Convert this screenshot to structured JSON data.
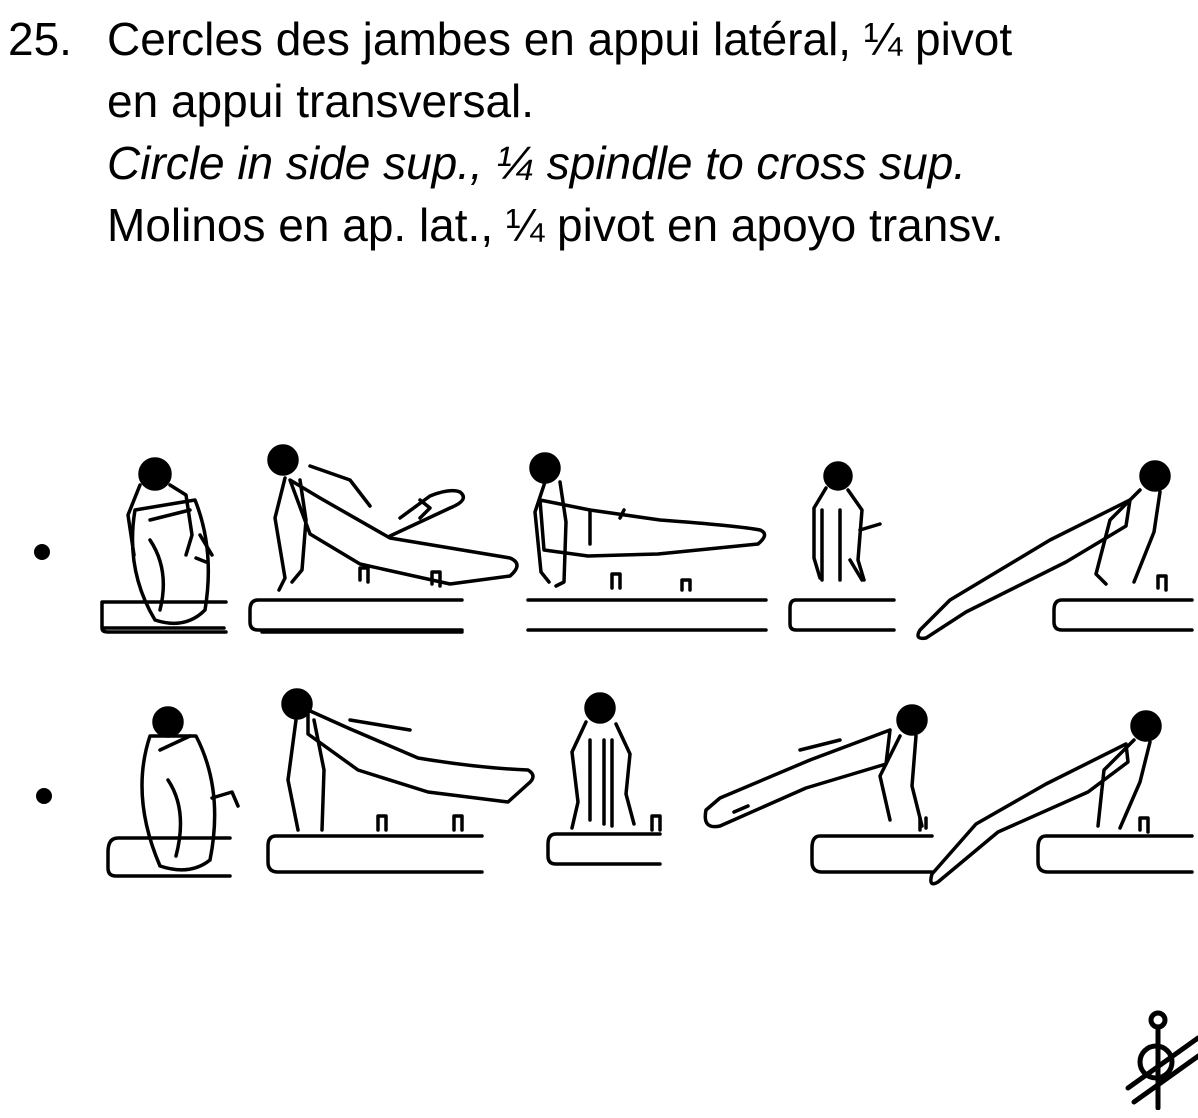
{
  "element": {
    "number": "25.",
    "fr_line1": "Cercles des jambes en appui latéral, ¼ pivot",
    "fr_line2": "en appui transversal.",
    "en_line": "Circle in side sup., ¼ spindle to cross sup.",
    "es_line": "Molinos en ap. lat., ¼ pivot en apoyo transv."
  },
  "illustration": {
    "rows": [
      {
        "bullet": "•",
        "figures": 5
      },
      {
        "bullet": "•",
        "figures": 5
      }
    ],
    "symbol_icon": "pommel-horse-symbol-icon"
  }
}
